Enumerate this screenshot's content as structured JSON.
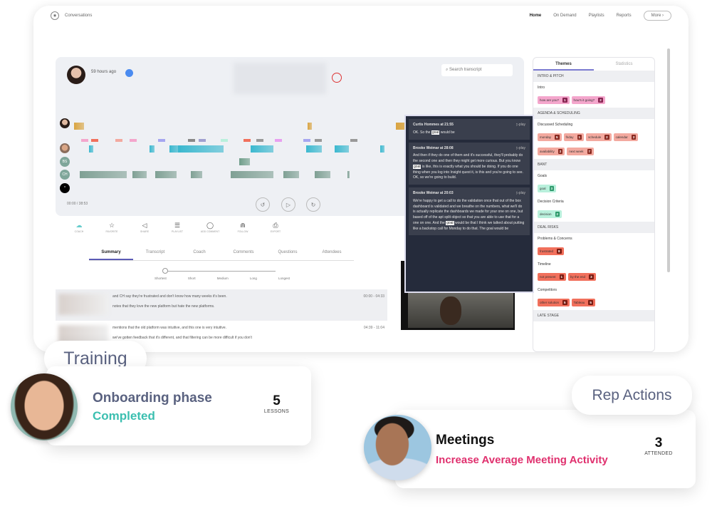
{
  "app": {
    "title": "Conversations",
    "nav": [
      "Home",
      "On Demand",
      "Playlists",
      "Reports"
    ],
    "more": "More ›"
  },
  "player": {
    "posted": "59 hours ago",
    "search_placeholder": "Search transcript",
    "time": "00:00 / 38:53",
    "speakers": [
      "BS",
      "CH"
    ]
  },
  "toolbar": [
    {
      "icon": "coach-icon",
      "label": "COACH"
    },
    {
      "icon": "star-icon",
      "label": "FAVORITE"
    },
    {
      "icon": "megaphone-icon",
      "label": "SHARE"
    },
    {
      "icon": "playlist-icon",
      "label": "PLAYLIST"
    },
    {
      "icon": "comment-icon",
      "label": "ADD COMMENT"
    },
    {
      "icon": "rss-icon",
      "label": "FOLLOW"
    },
    {
      "icon": "export-icon",
      "label": "EXPORT"
    }
  ],
  "tabs": [
    "Summary",
    "Transcript",
    "Coach",
    "Comments",
    "Questions",
    "Attendees"
  ],
  "summary_slider": {
    "labels": [
      "Shortest",
      "Short",
      "Medium",
      "Long",
      "Longest"
    ],
    "selected": "Shortest"
  },
  "summary": [
    {
      "lines": [
        "and CH say they're frustrated and don't know how many weeks it's been.",
        "notes that they love the new platform but hate the new platforms."
      ],
      "time": "00:00 - 04:33"
    },
    {
      "lines": [
        "mentions that the old platform was intuitive, and this one is very intuitive.",
        "we've gotten feedback that it's different, and that filtering can be more difficult if you don't"
      ],
      "time": "04:39 - 11:04"
    }
  ],
  "themes": {
    "tabs": [
      "Themes",
      "Statistics"
    ],
    "sections": [
      {
        "title": "INTRO & PITCH",
        "groups": [
          {
            "label": "Intro",
            "color": "#f4a6cc",
            "badge": "#8a2553",
            "chips": [
              [
                "how are you?",
                "1"
              ],
              [
                "how's it going?",
                "2"
              ]
            ]
          }
        ]
      },
      {
        "title": "AGENDA & SCHEDULING",
        "groups": [
          {
            "label": "Discussed Scheduling",
            "color": "#f3a99f",
            "badge": "#8a2b22",
            "chips": [
              [
                "monday",
                "5"
              ],
              [
                "friday",
                "1"
              ],
              [
                "schedule",
                "2"
              ],
              [
                "calendar",
                "2"
              ],
              [
                "availability",
                "2"
              ],
              [
                "next week",
                "7"
              ]
            ]
          }
        ]
      },
      {
        "title": "BANT",
        "groups": [
          {
            "label": "Goals",
            "color": "#b9f0dc",
            "badge": "#2f9a6c",
            "chips": [
              [
                "goal",
                "3"
              ]
            ]
          },
          {
            "label": "Decision Criteria",
            "color": "#b9f0dc",
            "badge": "#2f9a6c",
            "chips": [
              [
                "decision",
                "2"
              ]
            ]
          }
        ]
      },
      {
        "title": "DEAL RISKS",
        "groups": [
          {
            "label": "Problems & Concerns",
            "color": "#f1705c",
            "badge": "#7a1c12",
            "chips": [
              [
                "frustrated",
                "8"
              ]
            ]
          },
          {
            "label": "Timeline",
            "color": "#f1705c",
            "badge": "#7a1c12",
            "chips": [
              [
                "not present",
                "1"
              ],
              [
                "by the end",
                "3"
              ]
            ]
          },
          {
            "label": "Competitors",
            "color": "#f1705c",
            "badge": "#7a1c12",
            "chips": [
              [
                "other solution",
                "5"
              ],
              [
                "Tableau",
                "5"
              ]
            ]
          }
        ]
      },
      {
        "title": "LATE STAGE",
        "groups": []
      }
    ]
  },
  "popup": [
    {
      "speaker": "Curtis Hommes at 21:55",
      "play": "▷play",
      "text": [
        "OK. So the ",
        "goal",
        " would be"
      ]
    },
    {
      "speaker": "Brooke Weimar at 28:08",
      "play": "▷play",
      "text": [
        "And then if they do one of them and it's successful, they'll probably do the second one and then they might get more curious. But you know ",
        "goal",
        " is like, this is exactly what you should be doing. If you do one thing when you log into Insight quest it, is this and you're going to see. OK, so we're going to build."
      ]
    },
    {
      "speaker": "Brooke Weimar at 20:03",
      "play": "▷play",
      "text": [
        "We're happy to get a call to do the validation once that out of the box dashboard is validated and we breathe on the numbers, what we'll do is actually replicate the dashboards we made for your one on one, but based off of the apt split object so that you are able to use that for a one on one. And the ",
        "goal",
        " would be that I think we talked about putting like a backstop call for Monday to do that. The goal would be"
      ]
    }
  ],
  "training": {
    "pill": "Training",
    "title": "Onboarding phase",
    "status": "Completed",
    "count": "5",
    "count_label": "LESSONS",
    "title_color": "#5a6280",
    "status_color": "#3bbfb0"
  },
  "rep_actions": {
    "pill": "Rep Actions",
    "title": "Meetings",
    "subtitle": "Increase Average Meeting Activity",
    "count": "3",
    "count_label": "ATTENDED",
    "subtitle_color": "#e0306e"
  }
}
